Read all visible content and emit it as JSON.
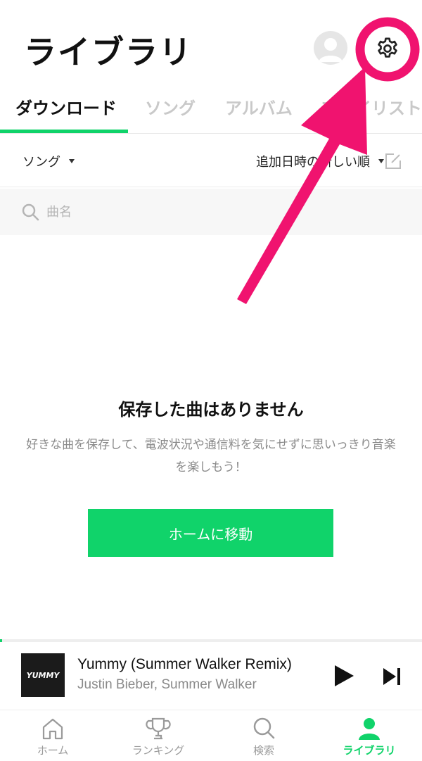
{
  "header": {
    "title": "ライブラリ"
  },
  "tabs": [
    {
      "label": "ダウンロード",
      "active": true
    },
    {
      "label": "ソング"
    },
    {
      "label": "アルバム"
    },
    {
      "label": "プレイリスト"
    }
  ],
  "filter": {
    "type_label": "ソング",
    "sort_label": "追加日時の新しい順"
  },
  "search": {
    "placeholder": "曲名"
  },
  "empty_state": {
    "title": "保存した曲はありません",
    "description": "好きな曲を保存して、電波状況や通信料を気にせずに思いっきり音楽を楽しもう！",
    "button_label": "ホームに移動"
  },
  "player": {
    "album_art_text": "YUMMY",
    "title": "Yummy (Summer Walker Remix)",
    "artist": "Justin Bieber, Summer Walker",
    "progress_percent": 0.5
  },
  "bottom_nav": {
    "items": [
      {
        "label": "ホーム",
        "icon": "home-icon"
      },
      {
        "label": "ランキング",
        "icon": "trophy-icon"
      },
      {
        "label": "検索",
        "icon": "search-icon"
      },
      {
        "label": "ライブラリ",
        "icon": "person-icon",
        "active": true
      }
    ]
  },
  "colors": {
    "accent": "#10d36a",
    "annotation": "#f0136f"
  }
}
